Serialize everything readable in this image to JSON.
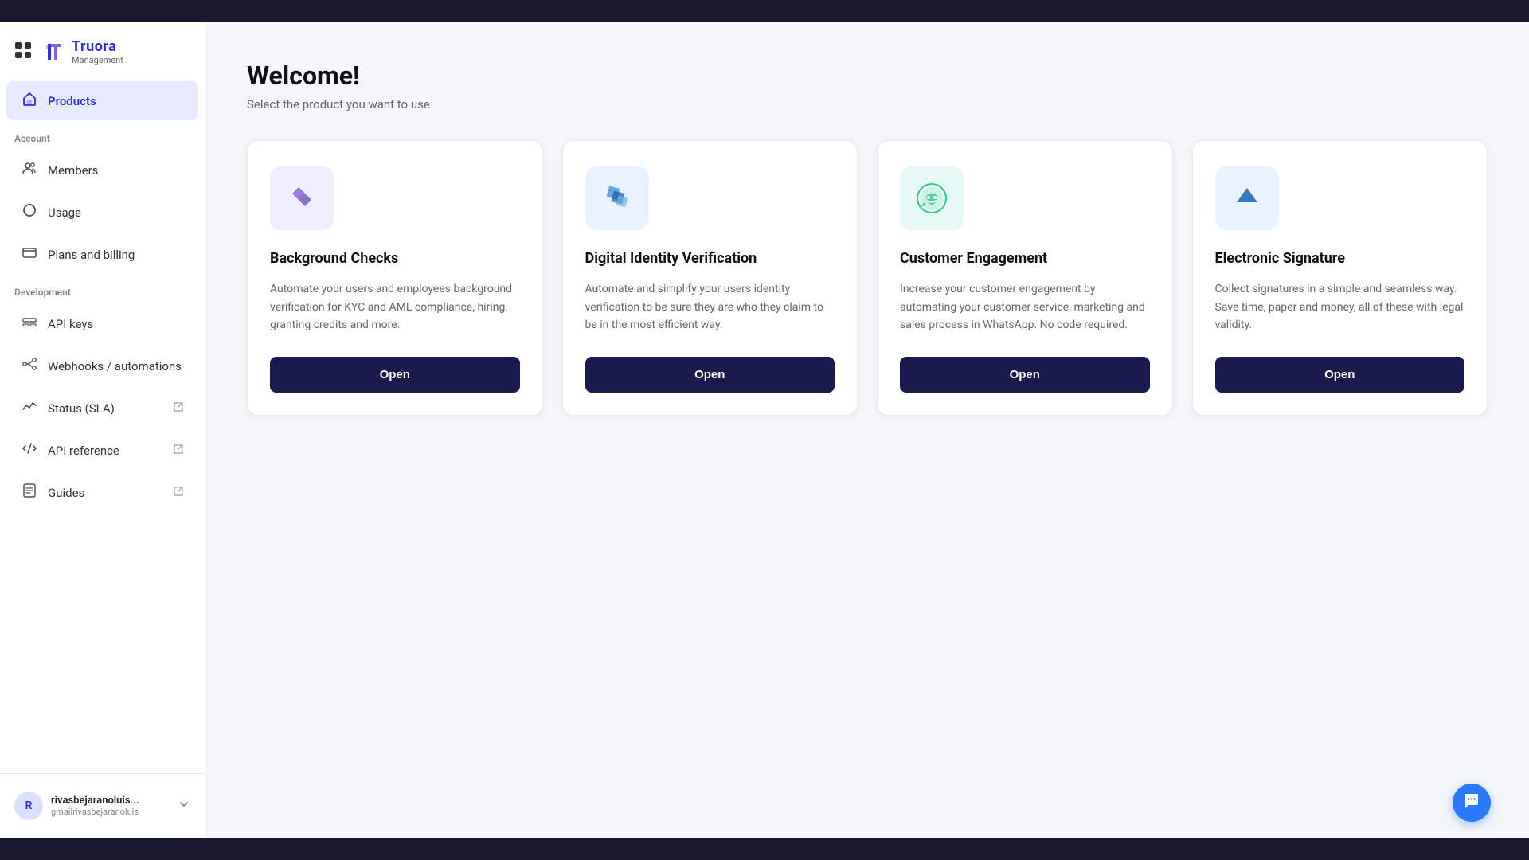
{
  "topBar": {},
  "sidebar": {
    "logo": {
      "name": "Truora",
      "sub": "Management"
    },
    "navItems": [
      {
        "id": "products",
        "label": "Products",
        "active": true,
        "icon": "home"
      }
    ],
    "accountSection": {
      "label": "Account",
      "items": [
        {
          "id": "members",
          "label": "Members",
          "icon": "people"
        },
        {
          "id": "usage",
          "label": "Usage",
          "icon": "circle"
        },
        {
          "id": "plans-billing",
          "label": "Plans and billing",
          "icon": "card"
        }
      ]
    },
    "developmentSection": {
      "label": "Development",
      "items": [
        {
          "id": "api-keys",
          "label": "API keys",
          "icon": "api",
          "external": false
        },
        {
          "id": "webhooks",
          "label": "Webhooks / automations",
          "icon": "webhook",
          "external": false
        },
        {
          "id": "status-sla",
          "label": "Status (SLA)",
          "icon": "status",
          "external": true
        },
        {
          "id": "api-reference",
          "label": "API reference",
          "icon": "api-ref",
          "external": true
        },
        {
          "id": "guides",
          "label": "Guides",
          "icon": "guides",
          "external": true
        }
      ]
    },
    "user": {
      "name": "rivasbejaranoluis...",
      "email": "gmailrivasbejaranoluis",
      "initials": "R"
    }
  },
  "main": {
    "title": "Welcome!",
    "subtitle": "Select the product you want to use",
    "products": [
      {
        "id": "background-checks",
        "title": "Background Checks",
        "description": "Automate your users and employees background verification for KYC and AML compliance, hiring, granting credits and more.",
        "buttonLabel": "Open",
        "iconBg": "purple"
      },
      {
        "id": "digital-identity",
        "title": "Digital Identity Verification",
        "description": "Automate and simplify your users identity verification to be sure they are who they claim to be in the most efficient way.",
        "buttonLabel": "Open",
        "iconBg": "blue"
      },
      {
        "id": "customer-engagement",
        "title": "Customer Engagement",
        "description": "Increase your customer engagement by automating your customer service, marketing and sales process in WhatsApp. No code required.",
        "buttonLabel": "Open",
        "iconBg": "teal"
      },
      {
        "id": "electronic-signature",
        "title": "Electronic Signature",
        "description": "Collect signatures in a simple and seamless way. Save time, paper and money, all of these with legal validity.",
        "buttonLabel": "Open",
        "iconBg": "lightblue"
      }
    ]
  },
  "chatBubble": {
    "ariaLabel": "Open chat"
  }
}
